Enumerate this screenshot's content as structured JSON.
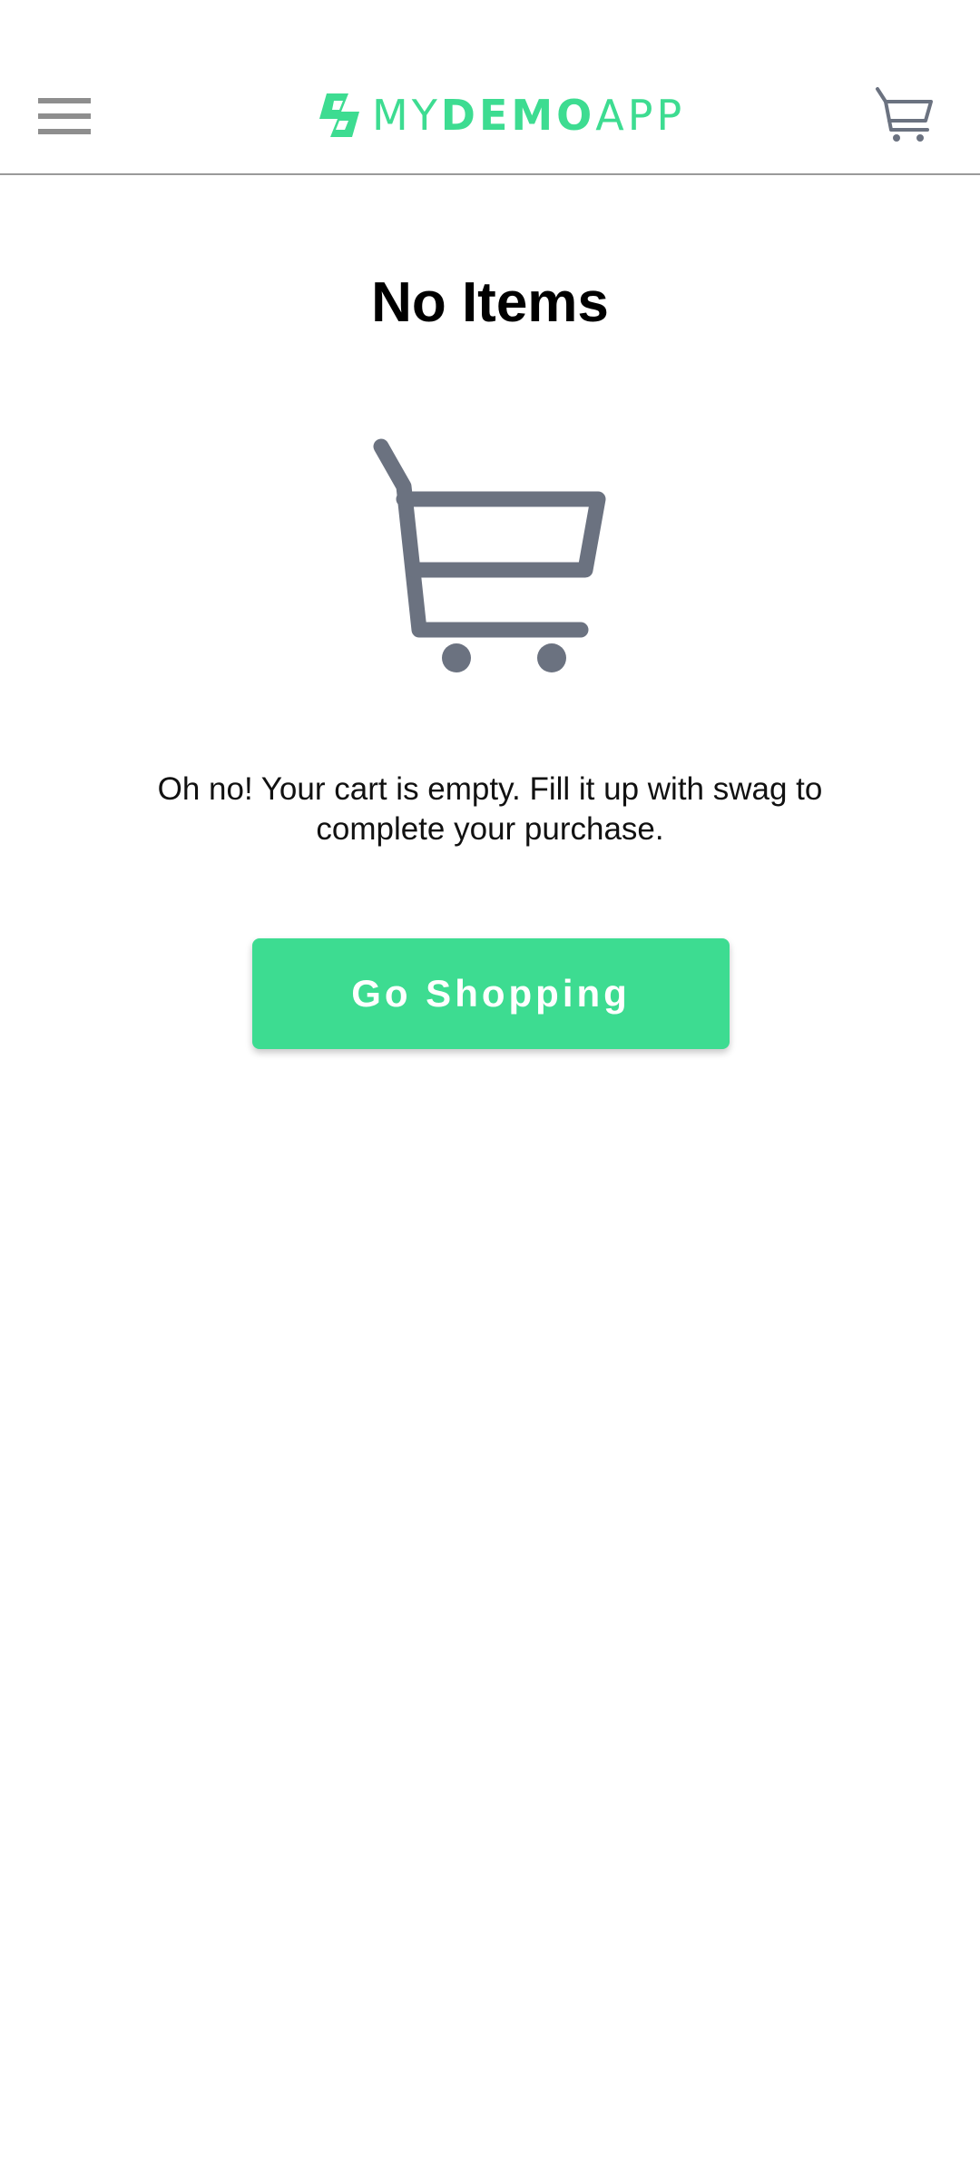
{
  "header": {
    "logo": {
      "parts": [
        "MY",
        "DEMO",
        "APP"
      ],
      "color": "#3ddc91"
    },
    "menu_icon": "hamburger-menu-icon",
    "cart_icon": "shopping-cart-icon"
  },
  "cart": {
    "title": "No Items",
    "image_icon": "empty-cart-icon",
    "message": "Oh no! Your cart is empty. Fill it up with swag to complete your purchase.",
    "button_label": "Go Shopping",
    "button_color": "#3ddc91",
    "icon_color": "#6b7280"
  }
}
